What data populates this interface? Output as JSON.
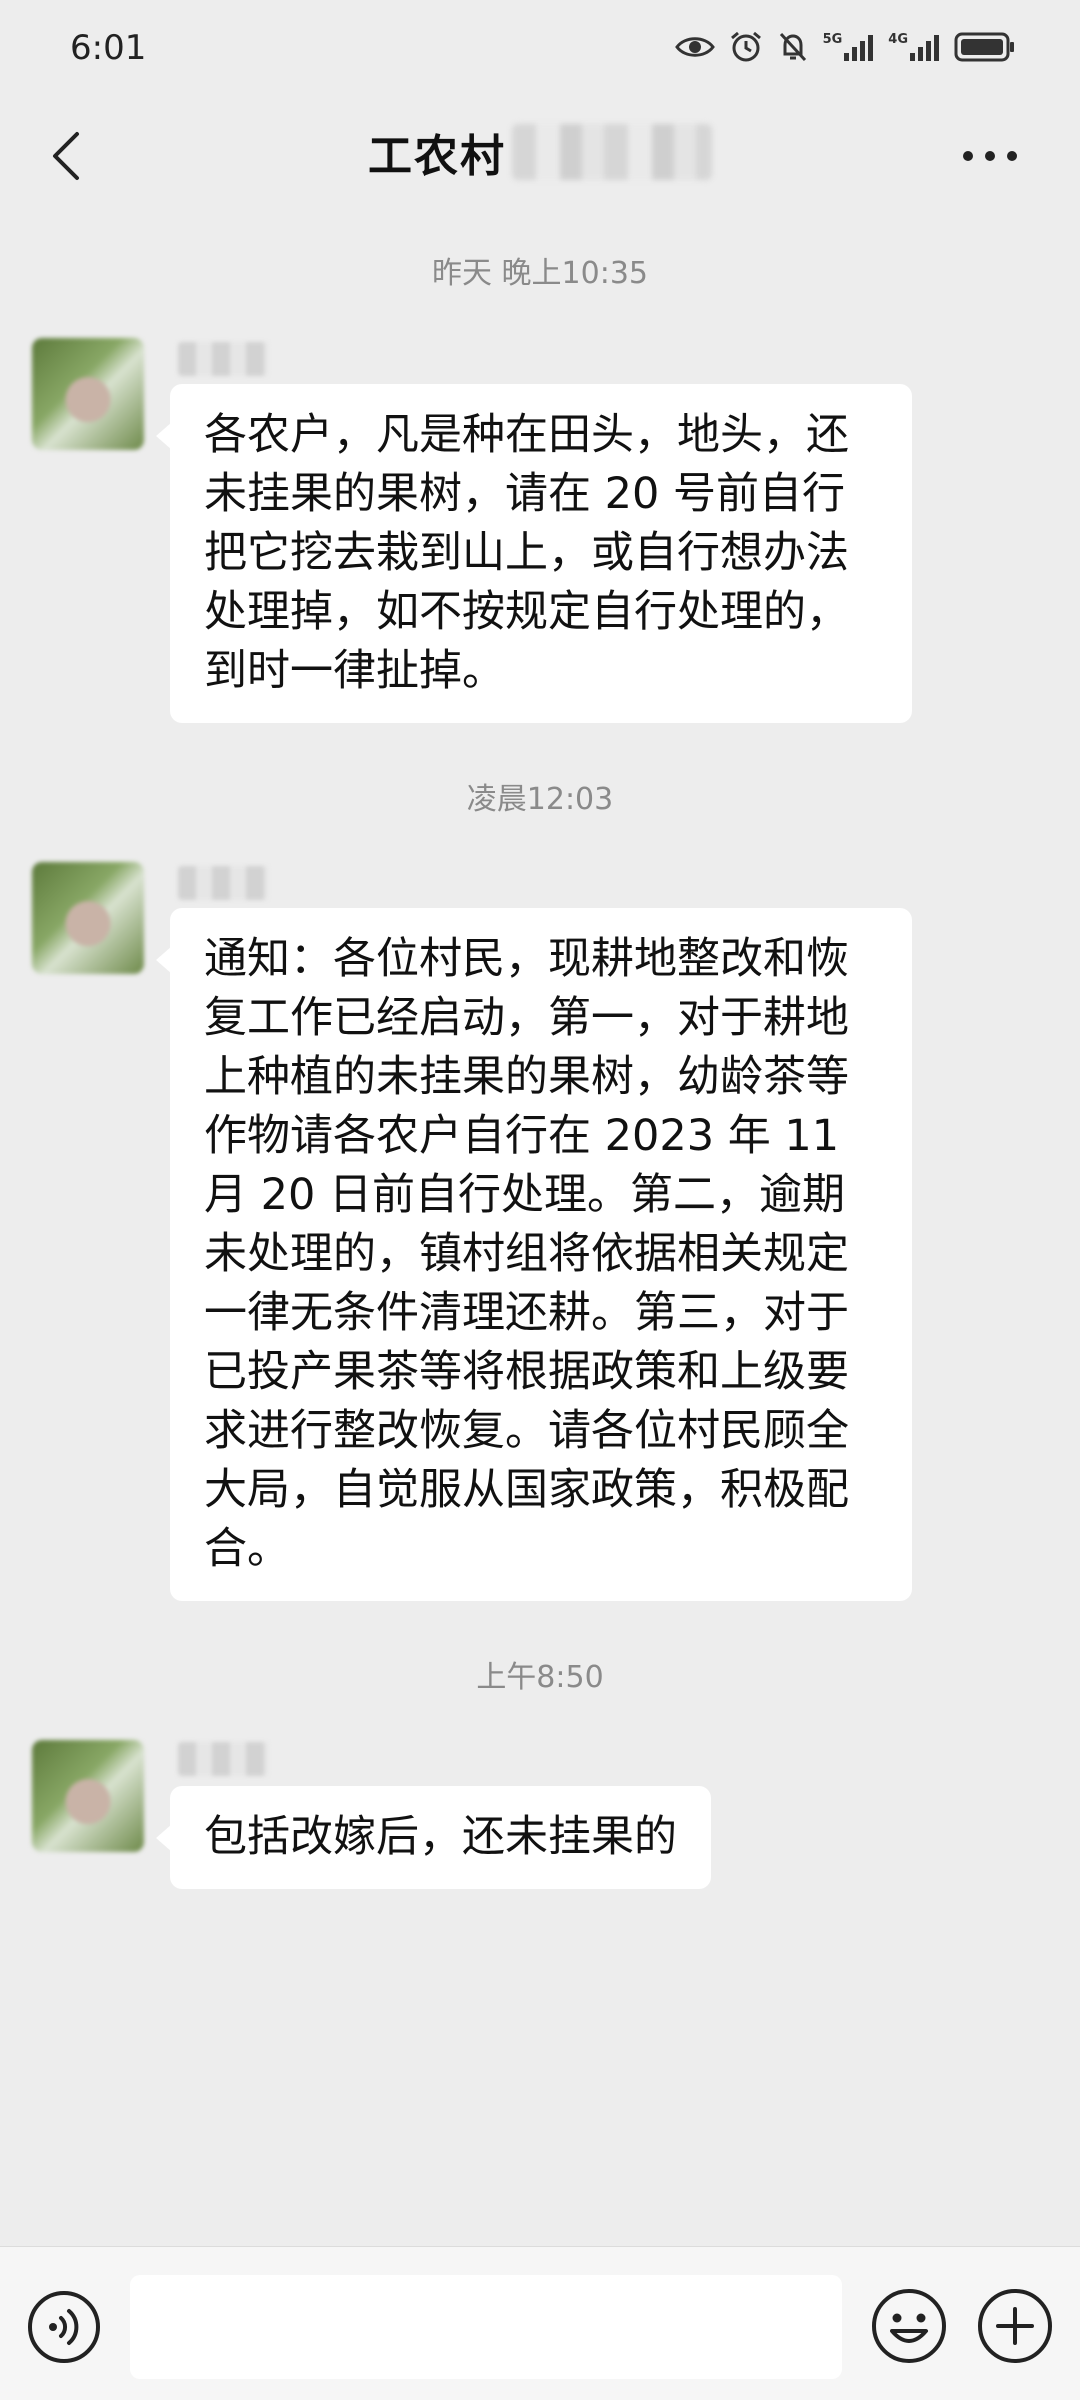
{
  "status_bar": {
    "time": "6:01",
    "signal_1": "5G",
    "signal_2": "4G"
  },
  "nav": {
    "title": "工农村"
  },
  "messages": [
    {
      "timestamp": "昨天 晚上10:35",
      "text": "各农户，凡是种在田头，地头，还未挂果的果树，请在 20 号前自行把它挖去栽到山上，或自行想办法处理掉，如不按规定自行处理的，到时一律扯掉。"
    },
    {
      "timestamp": "凌晨12:03",
      "text": "通知：各位村民，现耕地整改和恢复工作已经启动，第一，对于耕地上种植的未挂果的果树，幼龄茶等作物请各农户自行在 2023 年 11 月 20 日前自行处理。第二，逾期未处理的，镇村组将依据相关规定一律无条件清理还耕。第三，对于已投产果茶等将根据政策和上级要求进行整改恢复。请各位村民顾全大局，自觉服从国家政策，积极配合。"
    },
    {
      "timestamp": "上午8:50",
      "text": "包括改嫁后，还未挂果的"
    }
  ],
  "icons": {
    "back": "chevron-left-icon",
    "more": "more-dots-icon",
    "voice": "voice-icon",
    "emoji": "emoji-icon",
    "plus": "plus-icon"
  }
}
